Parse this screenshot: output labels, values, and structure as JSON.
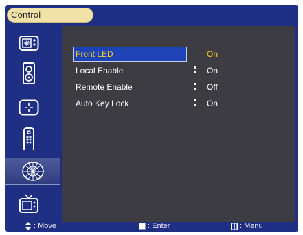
{
  "title": "Control",
  "sidebar": {
    "items": [
      {
        "icon": "display-panel-icon"
      },
      {
        "icon": "speaker-icon"
      },
      {
        "icon": "crosshair-icon"
      },
      {
        "icon": "remote-control-icon"
      },
      {
        "icon": "globe-network-icon",
        "active": true
      },
      {
        "icon": "tv-icon"
      }
    ]
  },
  "menu": {
    "items": [
      {
        "label": "Front LED",
        "value": "On",
        "selected": true
      },
      {
        "label": "Local Enable",
        "value": "On"
      },
      {
        "label": "Remote Enable",
        "value": "Off"
      },
      {
        "label": "Auto Key Lock",
        "value": "On"
      }
    ]
  },
  "footer": {
    "move": "Move",
    "enter": "Enter",
    "menu": "Menu"
  },
  "colors": {
    "frame": "#1f2f83",
    "panel": "#3d3c42",
    "selection": "#1e43b6",
    "highlight_text": "#f4cc22",
    "title_tab": "#f1e3a8"
  }
}
